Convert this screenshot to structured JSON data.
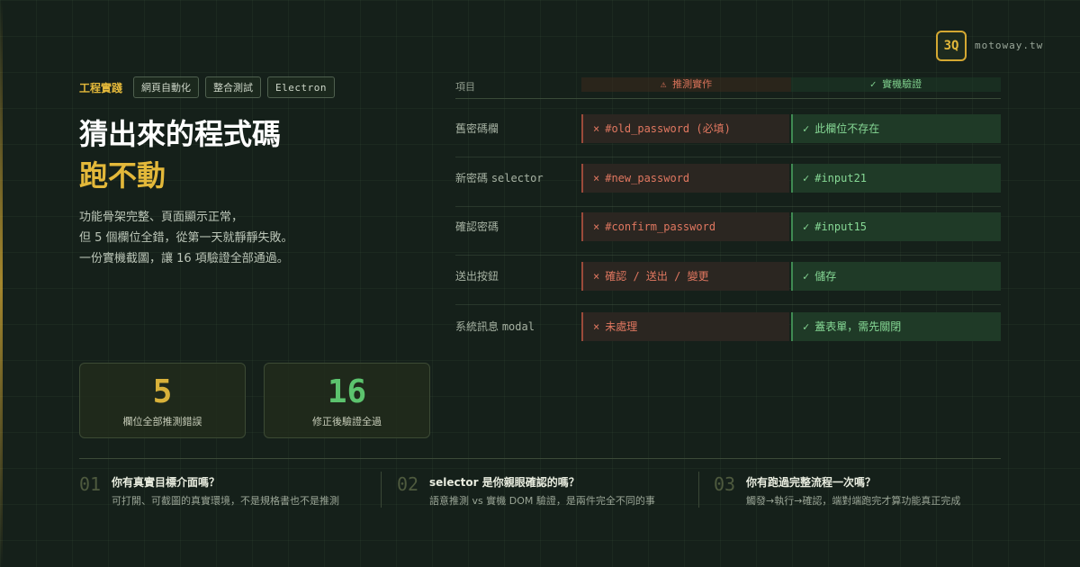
{
  "brand": {
    "logo": "3Q",
    "site": "motoway.tw"
  },
  "tags": {
    "main": "工程實踐",
    "items": [
      "網頁自動化",
      "整合測試",
      "Electron"
    ]
  },
  "title": {
    "line1": "猜出來的程式碼",
    "line2": "跑不動"
  },
  "description": [
    "功能骨架完整、頁面顯示正常，",
    "但 5 個欄位全錯，從第一天就靜靜失敗。",
    "一份實機截圖，讓 16 項驗證全部通過。"
  ],
  "stats": [
    {
      "value": "5",
      "label": "欄位全部推測錯誤"
    },
    {
      "value": "16",
      "label": "修正後驗證全過"
    }
  ],
  "table": {
    "header": {
      "item": "項目",
      "guess": "⚠ 推測實作",
      "verify": "✓ 實機驗證"
    },
    "rows": [
      {
        "item": "舊密碼欄",
        "item_code": "",
        "guess": "#old_password (必填)",
        "verify": "此欄位不存在"
      },
      {
        "item": "新密碼 ",
        "item_code": "selector",
        "guess": "#new_password",
        "verify": "#input21"
      },
      {
        "item": "確認密碼",
        "item_code": "",
        "guess": "#confirm_password",
        "verify": "#input15"
      },
      {
        "item": "送出按鈕",
        "item_code": "",
        "guess": "確認 / 送出 / 變更",
        "verify": "儲存"
      },
      {
        "item": "系統訊息 ",
        "item_code": "modal",
        "guess": "未處理",
        "verify": "蓋表單，需先關閉"
      }
    ],
    "bad_mark": "×",
    "good_mark": "✓"
  },
  "tips": [
    {
      "num": "01",
      "heading": "你有真實目標介面嗎？",
      "text": "可打開、可截圖的真實環境，不是規格書也不是推測"
    },
    {
      "num": "02",
      "heading": "selector 是你親眼確認的嗎？",
      "text": "語意推測 vs 實機 DOM 驗證，是兩件完全不同的事"
    },
    {
      "num": "03",
      "heading": "你有跑過完整流程一次嗎？",
      "text": "觸發→執行→確認，端對端跑完才算功能真正完成"
    }
  ],
  "colors": {
    "accent": "#e3b83a",
    "good": "#5cc36e",
    "bad": "#e07760",
    "background": "#15201a"
  }
}
